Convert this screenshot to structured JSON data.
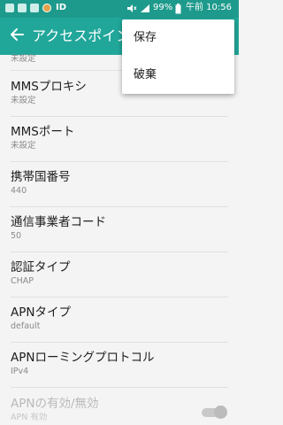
{
  "status_bar": {
    "id_label": "ID",
    "battery": "99%",
    "time": "午前 10:56",
    "icons": [
      "image-icon",
      "image-icon",
      "image-icon",
      "app-icon",
      "mute-icon",
      "signal-icon",
      "battery-icon"
    ]
  },
  "app_bar": {
    "title": "アクセスポイント"
  },
  "list": [
    {
      "title": "",
      "subtitle": "未設定"
    },
    {
      "title": "MMSプロキシ",
      "subtitle": "未設定"
    },
    {
      "title": "MMSポート",
      "subtitle": "未設定"
    },
    {
      "title": "携帯国番号",
      "subtitle": "440"
    },
    {
      "title": "通信事業者コード",
      "subtitle": "50"
    },
    {
      "title": "認証タイプ",
      "subtitle": "CHAP"
    },
    {
      "title": "APNタイプ",
      "subtitle": "default"
    },
    {
      "title": "APNローミングプロトコル",
      "subtitle": "IPv4"
    },
    {
      "title": "APNの有効/無効",
      "subtitle": "APN 有効"
    }
  ],
  "menu": {
    "items": [
      {
        "label": "保存"
      },
      {
        "label": "破棄"
      }
    ]
  },
  "colors": {
    "status_bar": "#1e9a8c",
    "app_bar": "#21a79a",
    "background": "#f4f4f4"
  }
}
